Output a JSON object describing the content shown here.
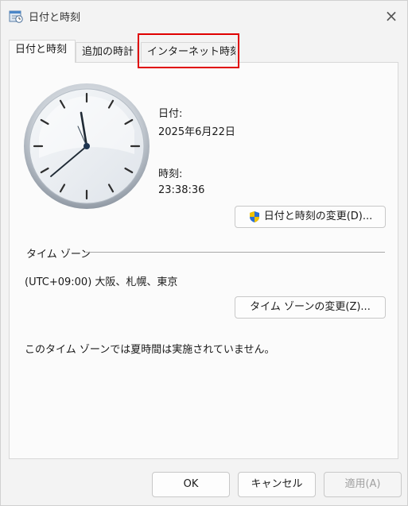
{
  "window": {
    "title": "日付と時刻"
  },
  "tabs": [
    {
      "label": "日付と時刻"
    },
    {
      "label": "追加の時計"
    },
    {
      "label": "インターネット時刻"
    }
  ],
  "datetime": {
    "date_label": "日付:",
    "date_value": "2025年6月22日",
    "time_label": "時刻:",
    "time_value": "23:38:36",
    "change_button": "日付と時刻の変更(D)..."
  },
  "timezone": {
    "section_label": "タイム ゾーン",
    "value": "(UTC+09:00) 大阪、札幌、東京",
    "change_button": "タイム ゾーンの変更(Z)...",
    "dst_note": "このタイム ゾーンでは夏時間は実施されていません。"
  },
  "footer": {
    "ok": "OK",
    "cancel": "キャンセル",
    "apply": "適用(A)"
  },
  "icons": {
    "app": "calendar-clock-icon",
    "close": "close-icon",
    "shield": "uac-shield-icon",
    "clock": "analog-clock"
  }
}
